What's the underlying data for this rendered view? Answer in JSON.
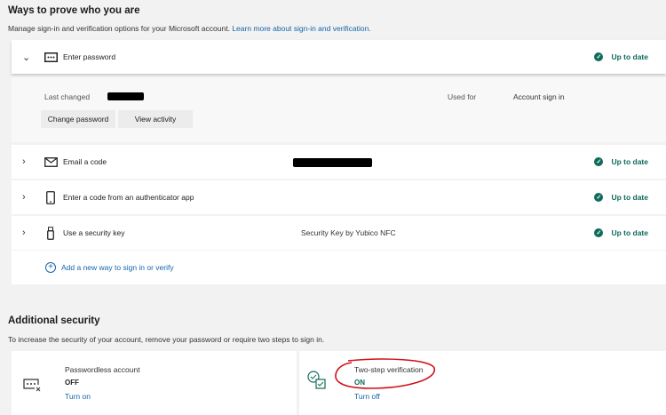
{
  "section1": {
    "title": "Ways to prove who you are",
    "description": "Manage sign-in and verification options for your Microsoft account.",
    "learn_more": "Learn more about sign-in and verification."
  },
  "password": {
    "label": "Enter password",
    "status": "Up to date",
    "last_changed_label": "Last changed",
    "used_for_label": "Used for",
    "used_for_value": "Account sign in",
    "change_button": "Change password",
    "activity_button": "View activity"
  },
  "methods": [
    {
      "label": "Email a code",
      "detail": "",
      "status": "Up to date",
      "icon": "envelope-icon"
    },
    {
      "label": "Enter a code from an authenticator app",
      "detail": "",
      "status": "Up to date",
      "icon": "phone-icon"
    },
    {
      "label": "Use a security key",
      "detail": "Security Key by Yubico NFC",
      "status": "Up to date",
      "icon": "usb-key-icon"
    }
  ],
  "add_method": "Add a new way to sign in or verify",
  "section2": {
    "title": "Additional security",
    "description": "To increase the security of your account, remove your password or require two steps to sign in."
  },
  "passwordless": {
    "title": "Passwordless account",
    "state": "OFF",
    "action": "Turn on"
  },
  "twostep": {
    "title": "Two-step verification",
    "state": "ON",
    "action": "Turn off"
  },
  "colors": {
    "accent": "#0f6b5b",
    "link": "#1565a8",
    "annotation": "#d0101a"
  }
}
